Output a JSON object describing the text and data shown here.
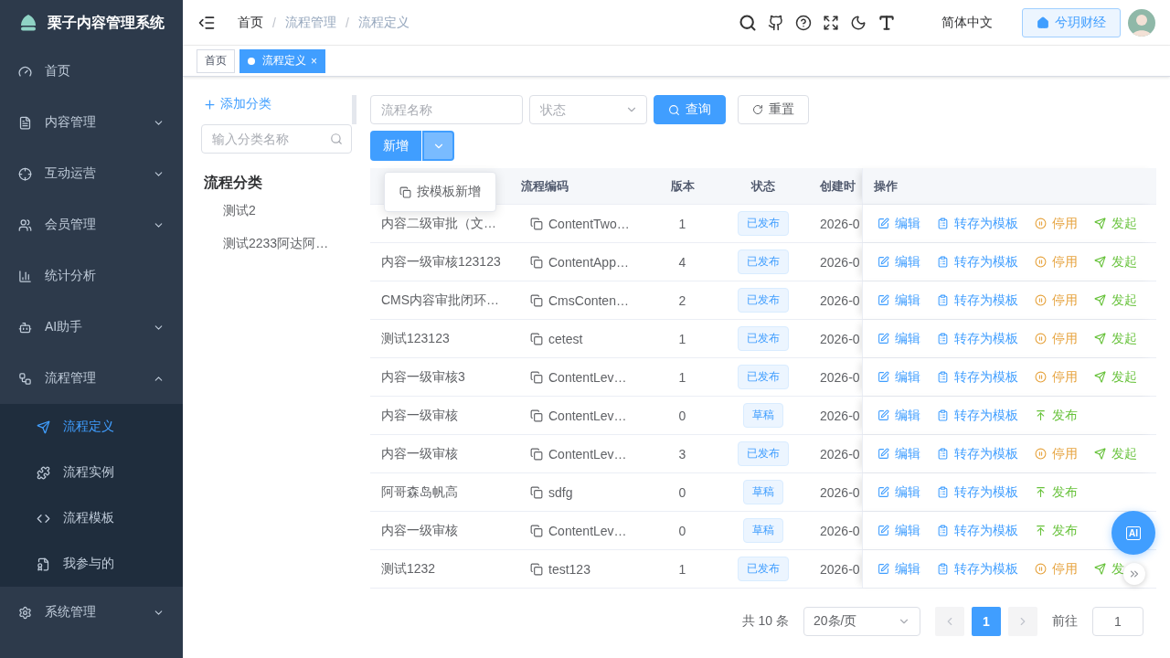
{
  "brand": {
    "title": "栗子内容管理系统"
  },
  "sidebar": {
    "items": [
      {
        "label": "首页",
        "kind": "link"
      },
      {
        "label": "内容管理",
        "kind": "group",
        "expanded": false
      },
      {
        "label": "互动运营",
        "kind": "group",
        "expanded": false
      },
      {
        "label": "会员管理",
        "kind": "group",
        "expanded": false
      },
      {
        "label": "统计分析",
        "kind": "link"
      },
      {
        "label": "AI助手",
        "kind": "group",
        "expanded": false
      },
      {
        "label": "流程管理",
        "kind": "group",
        "expanded": true,
        "children": [
          {
            "label": "流程定义",
            "selected": true
          },
          {
            "label": "流程实例",
            "selected": false
          },
          {
            "label": "流程模板",
            "selected": false
          },
          {
            "label": "我参与的",
            "selected": false
          }
        ]
      },
      {
        "label": "系统管理",
        "kind": "group",
        "expanded": false
      }
    ]
  },
  "header": {
    "breadcrumbs": [
      "首页",
      "流程管理",
      "流程定义"
    ],
    "separator": "/",
    "language": "简体中文",
    "tenant_button": "兮玥财经"
  },
  "tabs": [
    {
      "label": "首页",
      "selected": false
    },
    {
      "label": "流程定义",
      "selected": true,
      "close": "×"
    }
  ],
  "category_panel": {
    "add_button": "添加分类",
    "search": {
      "placeholder": "输入分类名称"
    },
    "title": "流程分类",
    "items": [
      "测试2",
      "测试2233阿达阿…"
    ]
  },
  "filters": {
    "name": {
      "placeholder": "流程名称"
    },
    "status": {
      "placeholder": "状态"
    },
    "query_button": "查询",
    "reset_button": "重置"
  },
  "add_button": {
    "label": "新增",
    "menu": [
      "按模板新增"
    ]
  },
  "table": {
    "columns": [
      "流程编码",
      "版本",
      "状态",
      "创建时",
      "操作"
    ],
    "rows": [
      {
        "name": "内容二级审批（文…",
        "code": "ContentTwo…",
        "version": "1",
        "status": "已发布",
        "date": "2026-0",
        "actions": [
          {
            "kind": "edit",
            "label": "编辑"
          },
          {
            "kind": "template",
            "label": "转存为模板"
          },
          {
            "kind": "disable",
            "label": "停用"
          },
          {
            "kind": "launch",
            "label": "发起"
          }
        ]
      },
      {
        "name": "内容一级审核123123",
        "code": "ContentApp…",
        "version": "4",
        "status": "已发布",
        "date": "2026-0",
        "actions": [
          {
            "kind": "edit",
            "label": "编辑"
          },
          {
            "kind": "template",
            "label": "转存为模板"
          },
          {
            "kind": "disable",
            "label": "停用"
          },
          {
            "kind": "launch",
            "label": "发起"
          }
        ]
      },
      {
        "name": "CMS内容审批闭环…",
        "code": "CmsConten…",
        "version": "2",
        "status": "已发布",
        "date": "2026-0",
        "actions": [
          {
            "kind": "edit",
            "label": "编辑"
          },
          {
            "kind": "template",
            "label": "转存为模板"
          },
          {
            "kind": "disable",
            "label": "停用"
          },
          {
            "kind": "launch",
            "label": "发起"
          }
        ]
      },
      {
        "name": "测试123123",
        "code": "cetest",
        "version": "1",
        "status": "已发布",
        "date": "2026-0",
        "actions": [
          {
            "kind": "edit",
            "label": "编辑"
          },
          {
            "kind": "template",
            "label": "转存为模板"
          },
          {
            "kind": "disable",
            "label": "停用"
          },
          {
            "kind": "launch",
            "label": "发起"
          }
        ]
      },
      {
        "name": "内容一级审核3",
        "code": "ContentLev…",
        "version": "1",
        "status": "已发布",
        "date": "2026-0",
        "actions": [
          {
            "kind": "edit",
            "label": "编辑"
          },
          {
            "kind": "template",
            "label": "转存为模板"
          },
          {
            "kind": "disable",
            "label": "停用"
          },
          {
            "kind": "launch",
            "label": "发起"
          }
        ]
      },
      {
        "name": "内容一级审核",
        "code": "ContentLev…",
        "version": "0",
        "status": "草稿",
        "date": "2026-0",
        "actions": [
          {
            "kind": "edit",
            "label": "编辑"
          },
          {
            "kind": "template",
            "label": "转存为模板"
          },
          {
            "kind": "publish",
            "label": "发布"
          }
        ]
      },
      {
        "name": "内容一级审核",
        "code": "ContentLev…",
        "version": "3",
        "status": "已发布",
        "date": "2026-0",
        "actions": [
          {
            "kind": "edit",
            "label": "编辑"
          },
          {
            "kind": "template",
            "label": "转存为模板"
          },
          {
            "kind": "disable",
            "label": "停用"
          },
          {
            "kind": "launch",
            "label": "发起"
          }
        ]
      },
      {
        "name": "阿哥森岛帆高",
        "code": "sdfg",
        "version": "0",
        "status": "草稿",
        "date": "2026-0",
        "actions": [
          {
            "kind": "edit",
            "label": "编辑"
          },
          {
            "kind": "template",
            "label": "转存为模板"
          },
          {
            "kind": "publish",
            "label": "发布"
          }
        ]
      },
      {
        "name": "内容一级审核",
        "code": "ContentLev…",
        "version": "0",
        "status": "草稿",
        "date": "2026-0",
        "actions": [
          {
            "kind": "edit",
            "label": "编辑"
          },
          {
            "kind": "template",
            "label": "转存为模板"
          },
          {
            "kind": "publish",
            "label": "发布"
          }
        ]
      },
      {
        "name": "测试1232",
        "code": "test123",
        "version": "1",
        "status": "已发布",
        "date": "2026-0",
        "actions": [
          {
            "kind": "edit",
            "label": "编辑"
          },
          {
            "kind": "template",
            "label": "转存为模板"
          },
          {
            "kind": "disable",
            "label": "停用"
          },
          {
            "kind": "launch",
            "label": "发"
          }
        ]
      }
    ]
  },
  "pagination": {
    "total": "共 10 条",
    "page_size": "20条/页",
    "pages": [
      {
        "label": "1",
        "selected": true
      }
    ],
    "goto_label": "前往",
    "goto_value": "1"
  },
  "ai_button": "AI"
}
